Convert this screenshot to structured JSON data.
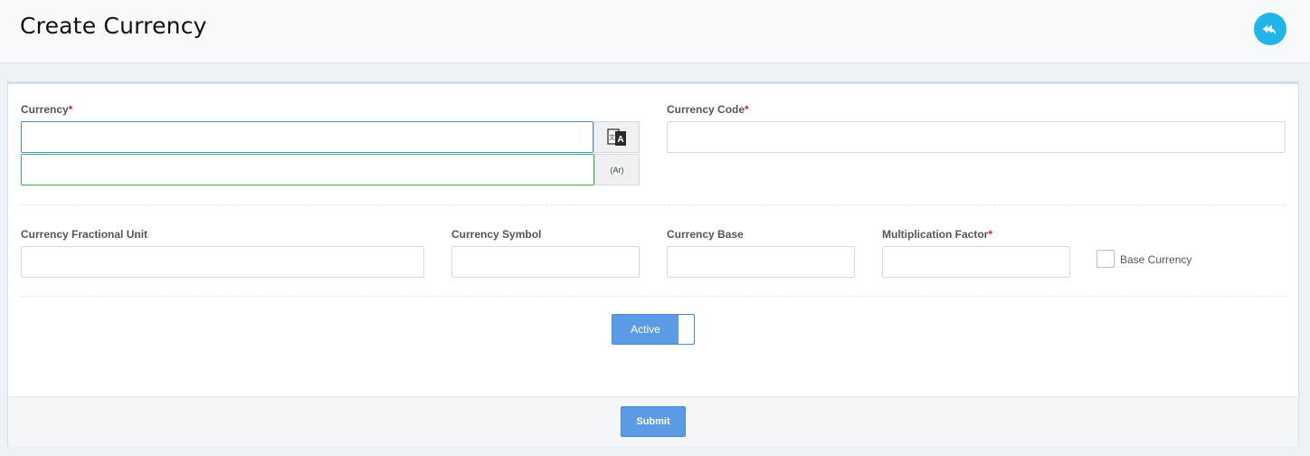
{
  "header": {
    "title": "Create Currency",
    "back_icon": "reply-arrow-icon"
  },
  "form": {
    "currency": {
      "label": "Currency",
      "required_mark": "*",
      "value": "",
      "value_ar": "",
      "translate_icon": "translate-icon",
      "ar_addon": "(Ar)"
    },
    "currency_code": {
      "label": "Currency Code",
      "required_mark": "*",
      "value": ""
    },
    "fractional_unit": {
      "label": "Currency Fractional Unit",
      "value": ""
    },
    "symbol": {
      "label": "Currency Symbol",
      "value": ""
    },
    "base": {
      "label": "Currency Base",
      "value": ""
    },
    "multiplication_factor": {
      "label": "Multiplication Factor",
      "required_mark": "*",
      "value": ""
    },
    "base_currency": {
      "label": "Base Currency",
      "checked": false
    },
    "active_toggle": {
      "label": "Active",
      "on": true
    }
  },
  "footer": {
    "submit_label": "Submit"
  },
  "colors": {
    "accent": "#20b5e8",
    "button": "#5b9be6",
    "required": "#e02020"
  }
}
